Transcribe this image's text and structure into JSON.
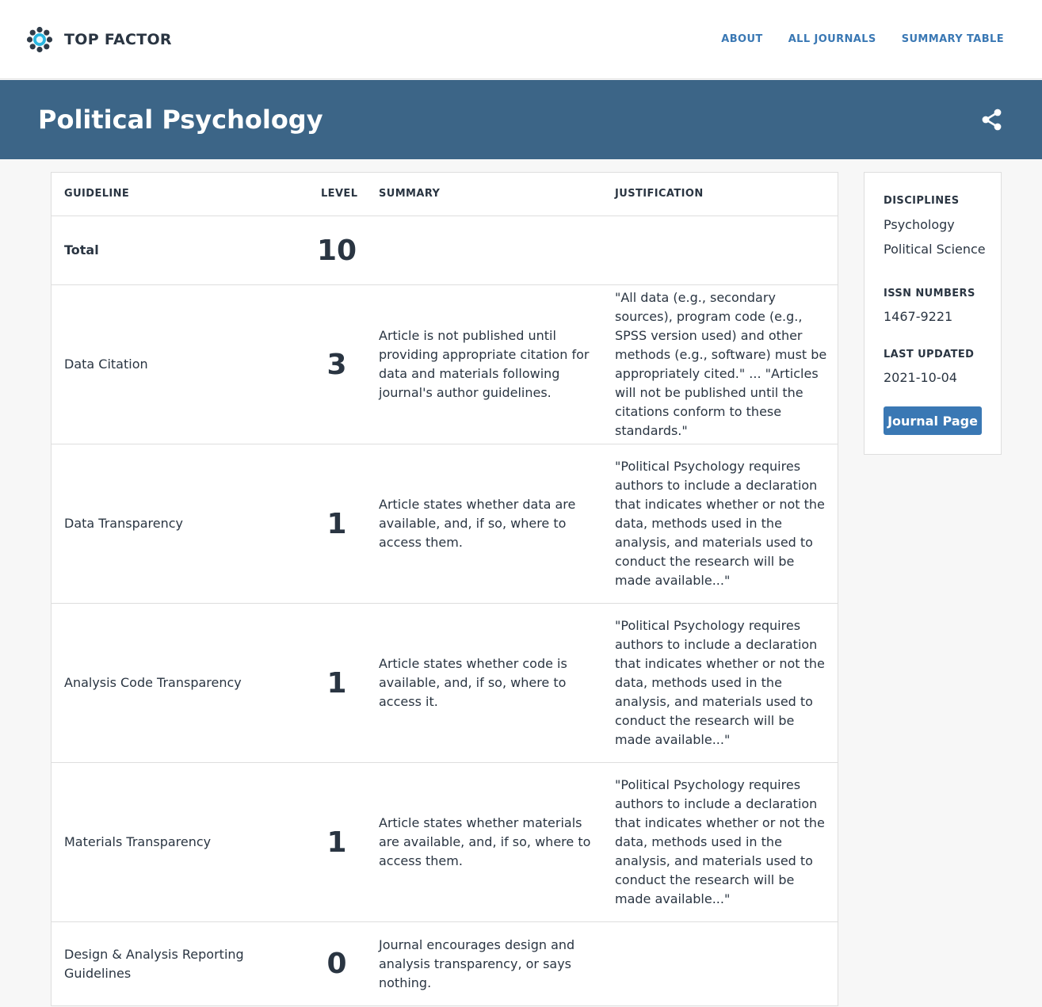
{
  "app": {
    "name": "TOP FACTOR",
    "logo_icon": "top-factor-logo-icon"
  },
  "nav": {
    "items": [
      {
        "label": "ABOUT"
      },
      {
        "label": "ALL JOURNALS"
      },
      {
        "label": "SUMMARY TABLE"
      }
    ]
  },
  "page": {
    "title": "Political Psychology",
    "share_icon": "share-icon"
  },
  "colors": {
    "hero_bg": "#3c6587",
    "accent": "#3a78b4",
    "text": "#2a3542"
  },
  "table": {
    "headers": {
      "guideline": "GUIDELINE",
      "level": "LEVEL",
      "summary": "SUMMARY",
      "justification": "JUSTIFICATION"
    },
    "total": {
      "label": "Total",
      "value": "10"
    },
    "rows": [
      {
        "guideline": "Data Citation",
        "level": "3",
        "summary": "Article is not published until providing appropriate citation for data and materials following journal's author guidelines.",
        "justification": "\"All data (e.g., secondary sources), program code (e.g., SPSS version used) and other methods (e.g., software) must be appropriately cited.\" ... \"Articles will not be published until the citations conform to these standards.\""
      },
      {
        "guideline": "Data Transparency",
        "level": "1",
        "summary": "Article states whether data are available, and, if so, where to access them.",
        "justification": "\"Political Psychology requires authors to include a declaration that indicates whether or not the data, methods used in the analysis, and materials used to conduct the research will be made available...\""
      },
      {
        "guideline": "Analysis Code Transparency",
        "level": "1",
        "summary": "Article states whether code is available, and, if so, where to access it.",
        "justification": "\"Political Psychology requires authors to include a declaration that indicates whether or not the data, methods used in the analysis, and materials used to conduct the research will be made available...\""
      },
      {
        "guideline": "Materials Transparency",
        "level": "1",
        "summary": "Article states whether materials are available, and, if so, where to access them.",
        "justification": "\"Political Psychology requires authors to include a declaration that indicates whether or not the data, methods used in the analysis, and materials used to conduct the research will be made available...\""
      },
      {
        "guideline": "Design & Analysis Reporting Guidelines",
        "level": "0",
        "summary": "Journal encourages design and analysis transparency, or says nothing.",
        "justification": ""
      }
    ]
  },
  "sidebar": {
    "disciplines_label": "DISCIPLINES",
    "disciplines": [
      "Psychology",
      "Political Science"
    ],
    "issn_label": "ISSN NUMBERS",
    "issn": "1467-9221",
    "updated_label": "LAST UPDATED",
    "updated": "2021-10-04",
    "journal_button": "Journal Page"
  }
}
